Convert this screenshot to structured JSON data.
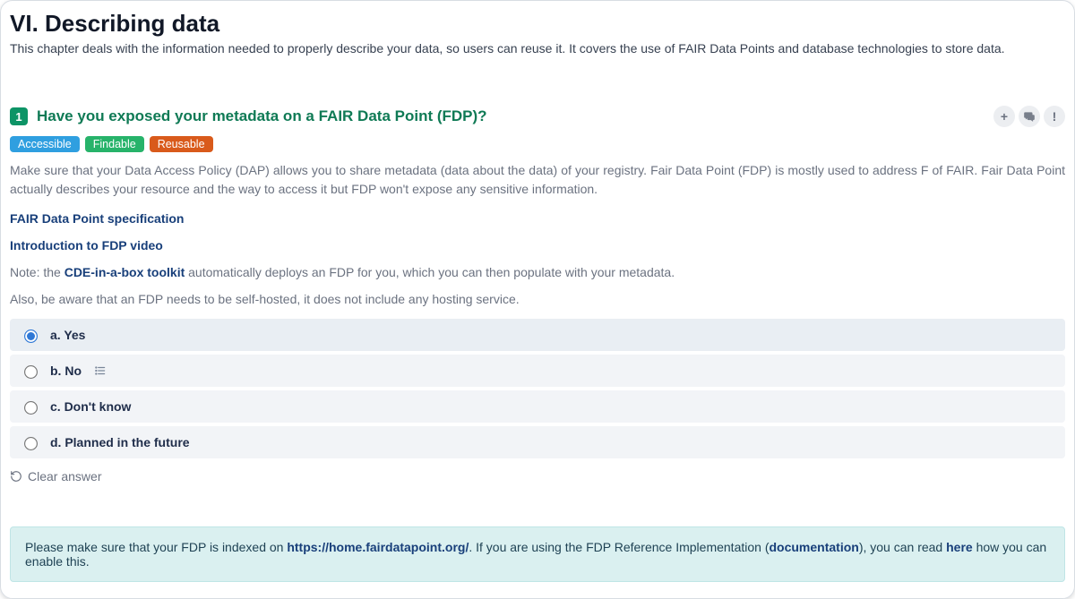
{
  "chapter": {
    "title": "VI. Describing data",
    "description": "This chapter deals with the information needed to properly describe your data, so users can reuse it. It covers the use of FAIR Data Points and database technologies to store data."
  },
  "question": {
    "number": "1",
    "title": "Have you exposed your metadata on a FAIR Data Point (FDP)?",
    "tags": {
      "accessible": "Accessible",
      "findable": "Findable",
      "reusable": "Reusable"
    },
    "intro": "Make sure that your Data Access Policy (DAP) allows you to share metadata (data about the data) of your registry. Fair Data Point (FDP) is mostly used to address F of FAIR. Fair Data Point actually describes your resource and the way to access it but FDP won't expose any sensitive information.",
    "links": {
      "spec": "FAIR Data Point specification",
      "video": "Introduction to FDP video"
    },
    "note": {
      "prefix": "Note: the ",
      "link": "CDE-in-a-box toolkit",
      "suffix": " automatically deploys an FDP for you, which you can then populate with your metadata."
    },
    "hosting_warning": "Also, be aware that an FDP needs to be self-hosted, it does not include any hosting service.",
    "options": {
      "a": "a. Yes",
      "b": "b. No",
      "c": "c. Don't know",
      "d": "d. Planned in the future"
    },
    "clear": "Clear answer"
  },
  "info": {
    "p1": "Please make sure that your FDP is indexed on ",
    "url": "https://home.fairdatapoint.org/",
    "p2": ". If you are using the FDP Reference Implementation (",
    "doc": "documentation",
    "p3": "), you can read ",
    "here": "here",
    "p4": " how you can enable this."
  },
  "icons": {
    "plus": "+",
    "comments": "💬",
    "alert": "!"
  }
}
